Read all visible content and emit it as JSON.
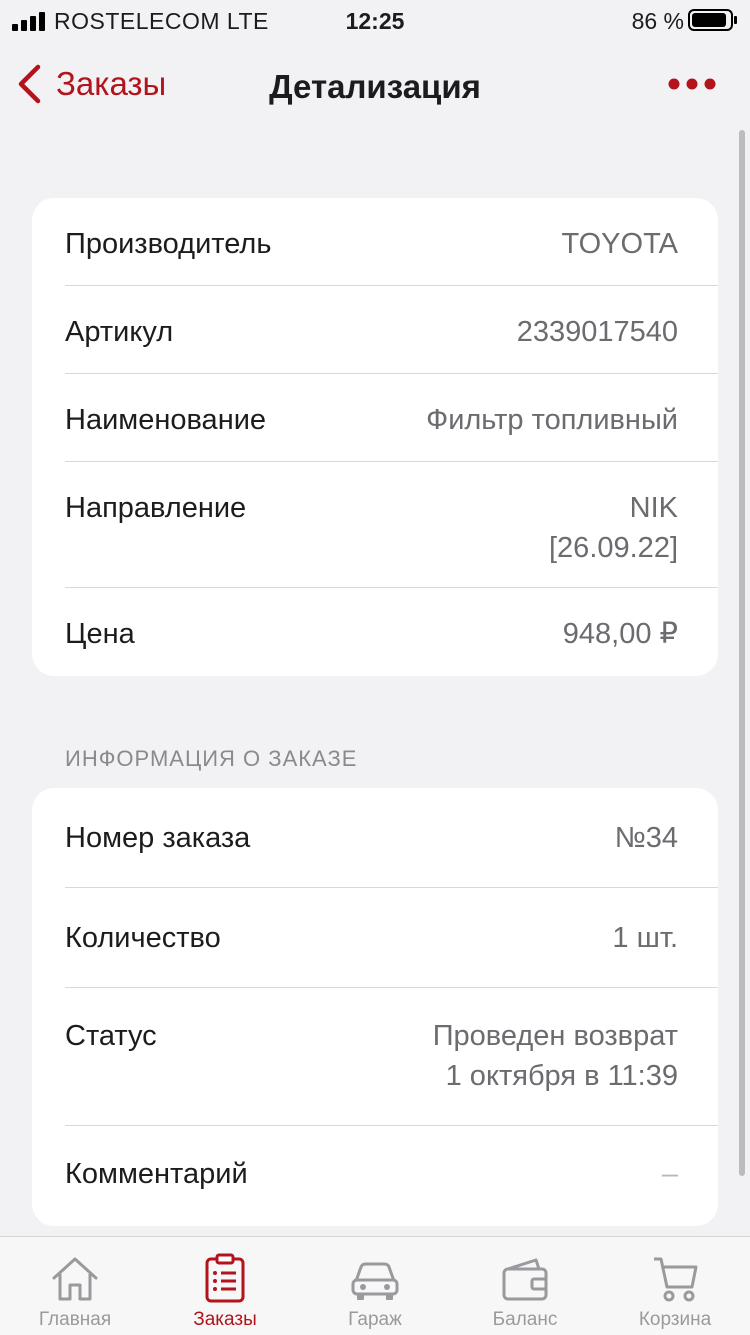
{
  "status_bar": {
    "carrier": "ROSTELECOM  LTE",
    "time": "12:25",
    "battery": "86 %"
  },
  "nav": {
    "back_label": "Заказы",
    "title": "Детализация",
    "more_icon": "more-dots-icon"
  },
  "details": [
    {
      "label": "Производитель",
      "value": "TOYOTA"
    },
    {
      "label": "Артикул",
      "value": "2339017540"
    },
    {
      "label": "Наименование",
      "value": "Фильтр топливный"
    },
    {
      "label": "Направление",
      "value": "NIK\n[26.09.22]"
    },
    {
      "label": "Цена",
      "value": "948,00 ₽"
    }
  ],
  "order_section": {
    "header": "ИНФОРМАЦИЯ О ЗАКАЗЕ",
    "rows": [
      {
        "label": "Номер заказа",
        "value": "№34"
      },
      {
        "label": "Количество",
        "value": "1 шт."
      },
      {
        "label": "Статус",
        "value": "Проведен возврат\n1 октября в 11:39"
      },
      {
        "label": "Комментарий",
        "value": "–"
      }
    ]
  },
  "tabs": [
    {
      "label": "Главная",
      "icon": "home-icon"
    },
    {
      "label": "Заказы",
      "icon": "orders-icon",
      "active": true
    },
    {
      "label": "Гараж",
      "icon": "car-icon"
    },
    {
      "label": "Баланс",
      "icon": "wallet-icon"
    },
    {
      "label": "Корзина",
      "icon": "cart-icon"
    }
  ],
  "colors": {
    "accent": "#b3131b",
    "background": "#f2f2f4",
    "inactive_tab": "#9a9a9e"
  }
}
